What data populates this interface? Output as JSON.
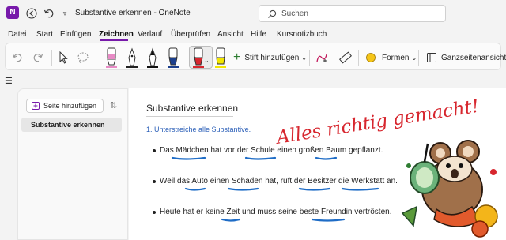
{
  "titlebar": {
    "app_logo": "N",
    "title": "Substantive erkennen  -  OneNote",
    "search_placeholder": "Suchen"
  },
  "menu": [
    {
      "label": "Datei"
    },
    {
      "label": "Start"
    },
    {
      "label": "Einfügen"
    },
    {
      "label": "Zeichnen",
      "active": true
    },
    {
      "label": "Verlauf"
    },
    {
      "label": "Überprüfen"
    },
    {
      "label": "Ansicht"
    },
    {
      "label": "Hilfe"
    },
    {
      "label": "Kursnotizbuch"
    }
  ],
  "ribbon": {
    "add_pen_label": "Stift hinzufügen",
    "add_pen_chevron": "⌄",
    "shapes_label": "Formen",
    "shapes_chevron": "⌄",
    "fullpage_label": "Ganzseitenansicht",
    "pens": [
      {
        "name": "pink",
        "color": "#e88bc6"
      },
      {
        "name": "black-fine",
        "color": "#222222"
      },
      {
        "name": "black",
        "color": "#111111"
      },
      {
        "name": "blue",
        "color": "#1c3f8c"
      },
      {
        "name": "red",
        "color": "#d7262e",
        "selected": true
      },
      {
        "name": "yellow",
        "color": "#f2e600"
      }
    ]
  },
  "sidebar": {
    "add_page_label": "Seite hinzufügen",
    "pages": [
      "Substantive erkennen"
    ]
  },
  "page": {
    "title": "Substantive erkennen",
    "instruction": "1. Unterstreiche alle Substantive.",
    "sentences": [
      "Das Mädchen hat vor der Schule einen großen Baum gepflanzt.",
      "Weil das Auto einen Schaden hat, ruft der Besitzer die Werkstatt an.",
      "Heute hat er keine Zeit und muss seine beste Freundin vertrösten."
    ],
    "ink_comment": "Alles richtig gemacht!"
  },
  "colors": {
    "accent": "#7719aa",
    "ink_red": "#d7262e",
    "ink_blue": "#1e6cc6",
    "instruction_blue": "#2b5fb8"
  }
}
